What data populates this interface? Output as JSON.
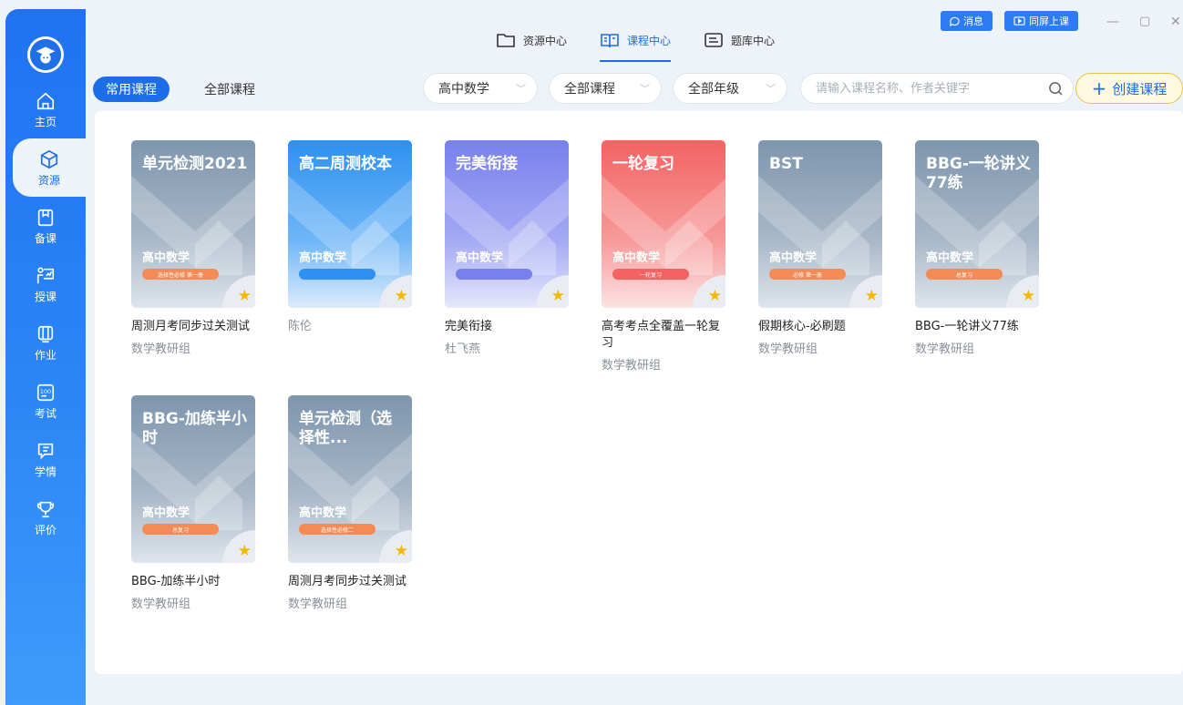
{
  "top_tabs": [
    {
      "label": "资源中心",
      "icon": "folder-icon"
    },
    {
      "label": "课程中心",
      "icon": "book-icon",
      "active": true
    },
    {
      "label": "题库中心",
      "icon": "question-bank-icon"
    }
  ],
  "top_buttons": {
    "message": "消息",
    "screen": "同屏上课"
  },
  "sidebar": [
    {
      "label": "主页",
      "icon": "home-icon"
    },
    {
      "label": "资源",
      "icon": "cube-icon",
      "active": true
    },
    {
      "label": "备课",
      "icon": "prepare-icon"
    },
    {
      "label": "授课",
      "icon": "teach-icon"
    },
    {
      "label": "作业",
      "icon": "homework-icon"
    },
    {
      "label": "考试",
      "icon": "exam-icon"
    },
    {
      "label": "学情",
      "icon": "analysis-icon"
    },
    {
      "label": "评价",
      "icon": "trophy-icon"
    }
  ],
  "filter": {
    "tab_common": "常用课程",
    "tab_all": "全部课程",
    "subject": "高中数学",
    "course_type": "全部课程",
    "grade": "全部年级",
    "search_placeholder": "请输入课程名称、作者关键字",
    "create": "创建课程"
  },
  "colors": {
    "primary": "#1d6de8",
    "gray_card": "#7e96ae",
    "blue_card": "#2e90f0",
    "purple_card": "#7880ee",
    "red_card": "#f46262",
    "tag_orange": "#f58a55",
    "star": "#f4b800"
  },
  "courses": [
    {
      "title": "单元检测2021",
      "subject": "高中数学",
      "tag": "选择性必修 第一册",
      "name": "周测月考同步过关测试",
      "author": "数学教研组",
      "color": "gray"
    },
    {
      "title": "高二周测校本",
      "subject": "高中数学",
      "tag": "",
      "name": "陈伦",
      "author": "",
      "color": "blue"
    },
    {
      "title": "完美衔接",
      "subject": "高中数学",
      "tag": "",
      "name": "完美衔接",
      "author": "杜飞燕",
      "color": "purple"
    },
    {
      "title": "一轮复习",
      "subject": "高中数学",
      "tag": "一轮复习",
      "name": "高考考点全覆盖一轮复习",
      "author": "数学教研组",
      "color": "red"
    },
    {
      "title": "BST",
      "subject": "高中数学",
      "tag": "必修 第一册",
      "name": "假期核心-必刷题",
      "author": "数学教研组",
      "color": "gray"
    },
    {
      "title": "BBG-一轮讲义77练",
      "subject": "高中数学",
      "tag": "总复习",
      "name": "BBG-一轮讲义77练",
      "author": "数学教研组",
      "color": "gray"
    },
    {
      "title": "BBG-加练半小时",
      "subject": "高中数学",
      "tag": "总复习",
      "name": "BBG-加练半小时",
      "author": "数学教研组",
      "color": "gray"
    },
    {
      "title": "单元检测（选择性...",
      "subject": "高中数学",
      "tag": "选择性必修二",
      "name": "周测月考同步过关测试",
      "author": "数学教研组",
      "color": "gray"
    }
  ]
}
